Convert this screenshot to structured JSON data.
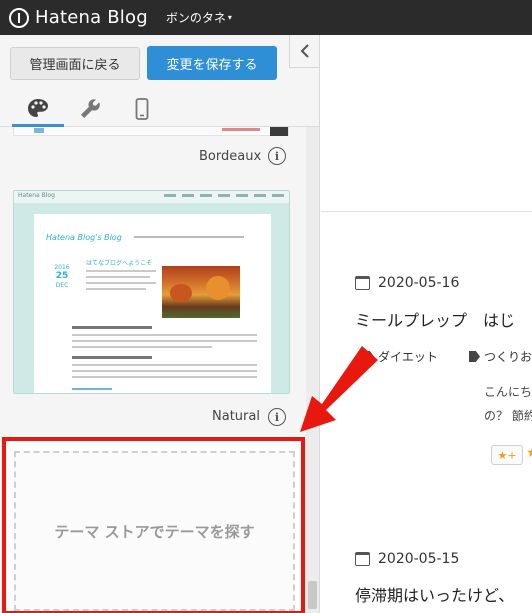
{
  "topbar": {
    "logo_text": "Hatena Blog",
    "blog_name": "ボンのタネ"
  },
  "sidebar": {
    "back_button": "管理画面に戻る",
    "save_button": "変更を保存する",
    "tabs": [
      "design",
      "customize",
      "smartphone"
    ],
    "themes": [
      {
        "name": "Bordeaux"
      },
      {
        "name": "Natural",
        "preview": {
          "logo": "Hatena Blog",
          "title": "Hatena Blog's Blog",
          "post_title": "はてなブログへようこそ",
          "date_year": "2016",
          "date_day": "25",
          "date_month": "DEC"
        }
      }
    ],
    "store_link": "テーマ ストアでテーマを探す"
  },
  "content": {
    "posts": [
      {
        "date": "2020-05-16",
        "title": "ミールプレップ　はじ",
        "tags": [
          "ダイエット",
          "つくりお"
        ],
        "excerpt_1": "こんにち",
        "excerpt_2": "の？ 節約"
      },
      {
        "date": "2020-05-15",
        "title": "停滞期はいったけど、"
      }
    ],
    "star_button": "★+"
  },
  "colors": {
    "accent": "#2e8ed6",
    "highlight": "#e8180f",
    "topbar": "#2b2b2b"
  }
}
